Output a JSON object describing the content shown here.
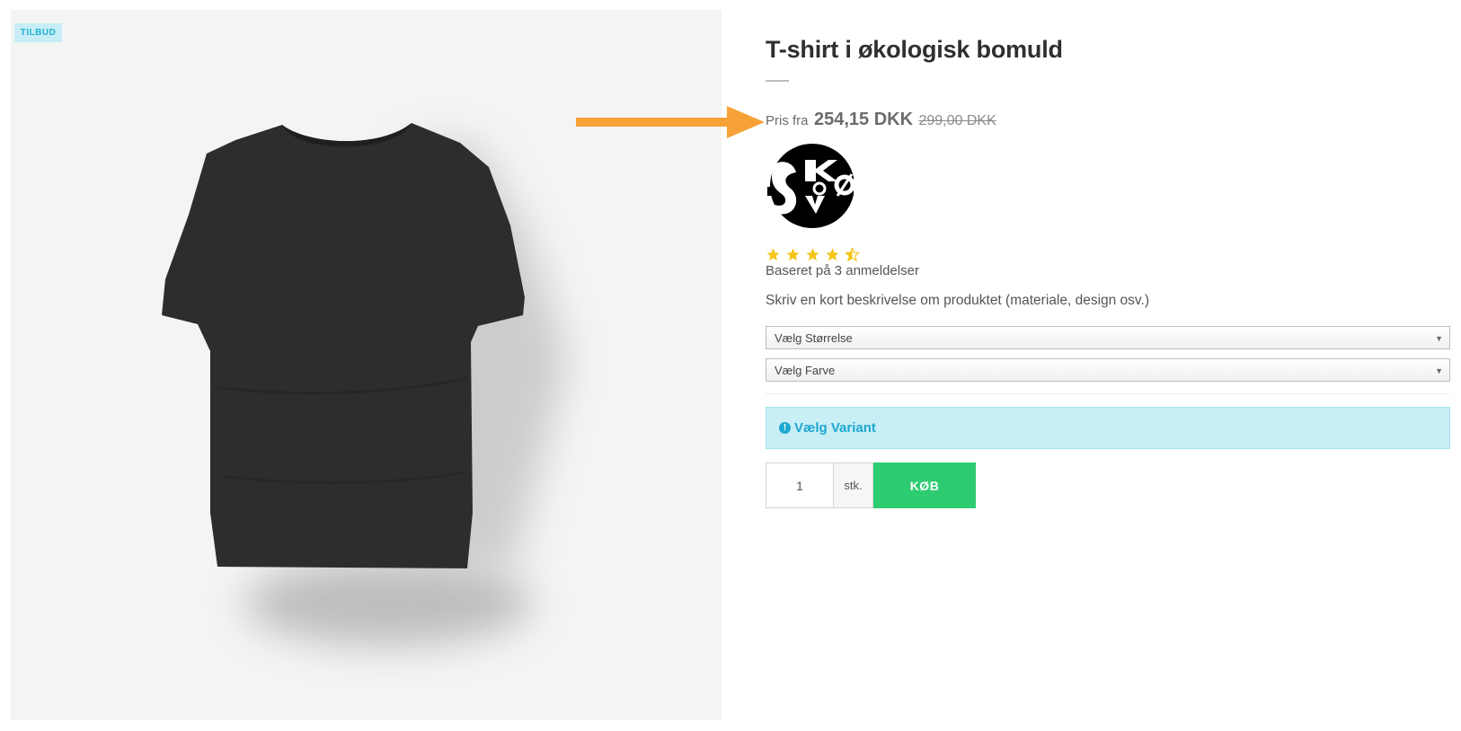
{
  "product": {
    "badge": "TILBUD",
    "title": "T-shirt i økologisk bomuld",
    "price_prefix": "Pris fra",
    "price_current": "254,15 DKK",
    "price_original": "299,00 DKK",
    "rating": 4.5,
    "rating_max": 5,
    "reviews_text": "Baseret på 3 anmeldelser",
    "short_description": "Skriv en kort beskrivelse om produktet (materiale, design osv.)"
  },
  "variants": {
    "size_select": "Vælg Størrelse",
    "color_select": "Vælg Farve"
  },
  "alert": {
    "icon": "exclamation-circle-icon",
    "text": "Vælg Variant",
    "color": "#1ea8cf"
  },
  "purchase": {
    "quantity": "1",
    "unit": "stk.",
    "buy_label": "KØB",
    "buy_color": "#2ecc71"
  },
  "colors": {
    "badge_bg": "#c7edf6",
    "arrow": "#f7a239",
    "star": "#f5c518"
  }
}
